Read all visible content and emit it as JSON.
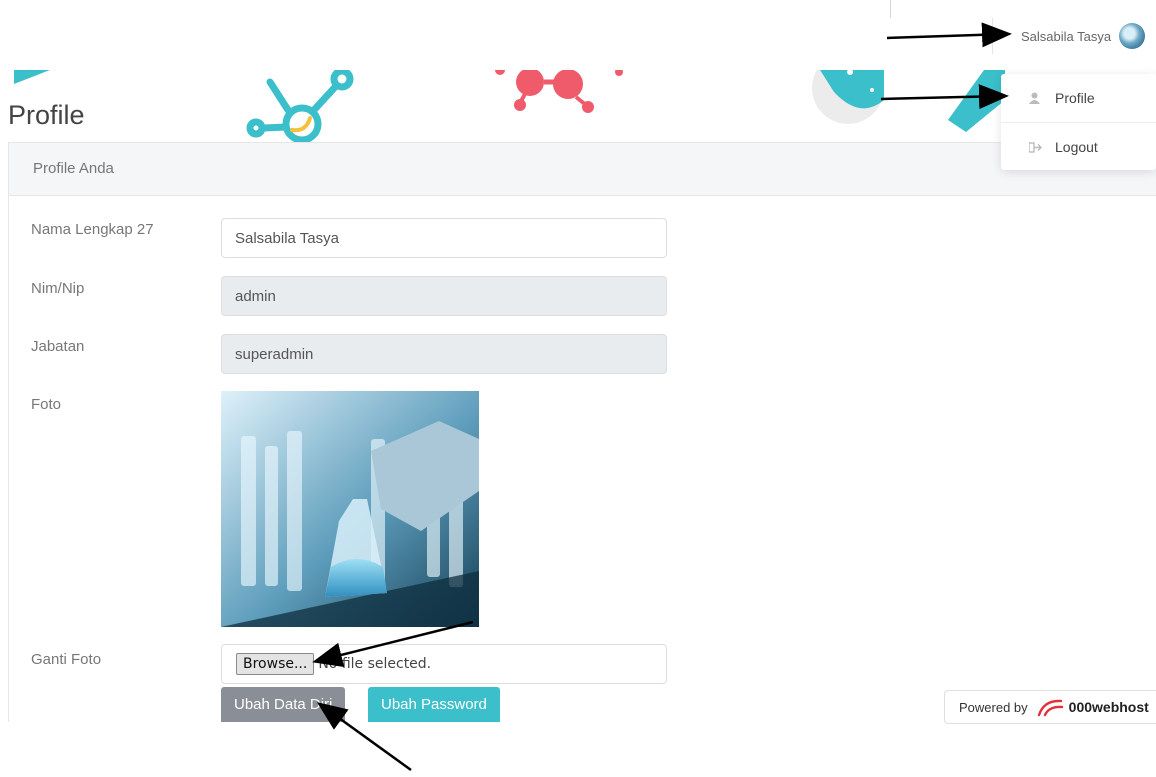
{
  "header": {
    "user_name": "Salsabila Tasya"
  },
  "dropdown": {
    "items": [
      {
        "label": "Profile",
        "icon": "user-icon"
      },
      {
        "label": "Logout",
        "icon": "logout-icon"
      }
    ]
  },
  "page": {
    "title": "Profile"
  },
  "card": {
    "title": "Profile Anda",
    "fields": [
      {
        "label": "Nama Lengkap 27",
        "value": "Salsabila Tasya"
      },
      {
        "label": "Nim/Nip",
        "value": "admin"
      },
      {
        "label": "Jabatan",
        "value": "superadmin"
      },
      {
        "label": "Foto"
      },
      {
        "label": "Ganti Foto"
      }
    ],
    "file_input": {
      "button_label": "Browse...",
      "status": "No file selected."
    },
    "buttons": {
      "update_profile": "Ubah Data Diri",
      "change_password": "Ubah Password"
    }
  },
  "footer": {
    "powered_by": "Powered by",
    "brand": "000webhost"
  },
  "colors": {
    "teal": "#3bbfcb",
    "coral": "#ef5b6b",
    "grey_button": "#8a8e97"
  }
}
